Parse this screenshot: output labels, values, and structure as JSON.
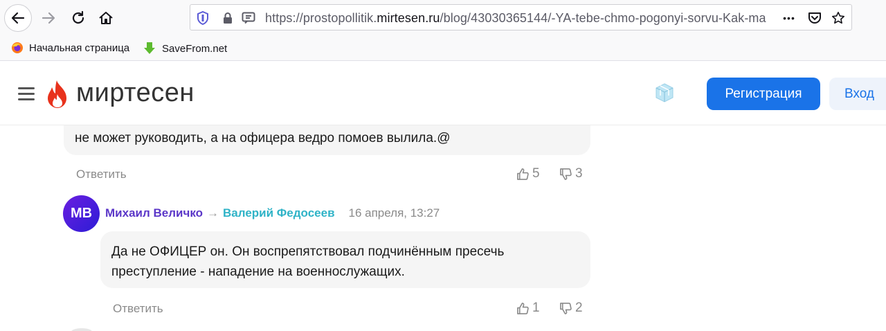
{
  "browser": {
    "url_prefix": "https://prostopollitik.",
    "url_domain": "mirtesen.ru",
    "url_path": "/blog/43030365144/-YA-tebe-chmo-pogonyi-sorvu-Kak-ma",
    "more_label": "•••",
    "bookmarks": [
      {
        "label": "Начальная страница",
        "icon": "firefox-icon"
      },
      {
        "label": "SaveFrom.net",
        "icon": "savefrom-icon"
      }
    ]
  },
  "site": {
    "logo_text": "миртесен",
    "register_label": "Регистрация",
    "login_label": "Вход",
    "accent_color": "#1a73e8"
  },
  "comments": [
    {
      "text": "не может руководить, а на офицера ведро помоев вылила.@",
      "reply_label": "Ответить",
      "likes": "5",
      "dislikes": "3"
    },
    {
      "avatar_initials": "МВ",
      "author": "Михаил Величко",
      "arrow": "→",
      "reply_to": "Валерий Федосеев",
      "date": "16 апреля, 13:27",
      "text_line1": "Да не ОФИЦЕР он. Он воспрепятствовал подчинённым пресечь",
      "text_line2": "преступление - нападение на военнослужащих.",
      "reply_label": "Ответить",
      "likes": "1",
      "dislikes": "2"
    }
  ]
}
